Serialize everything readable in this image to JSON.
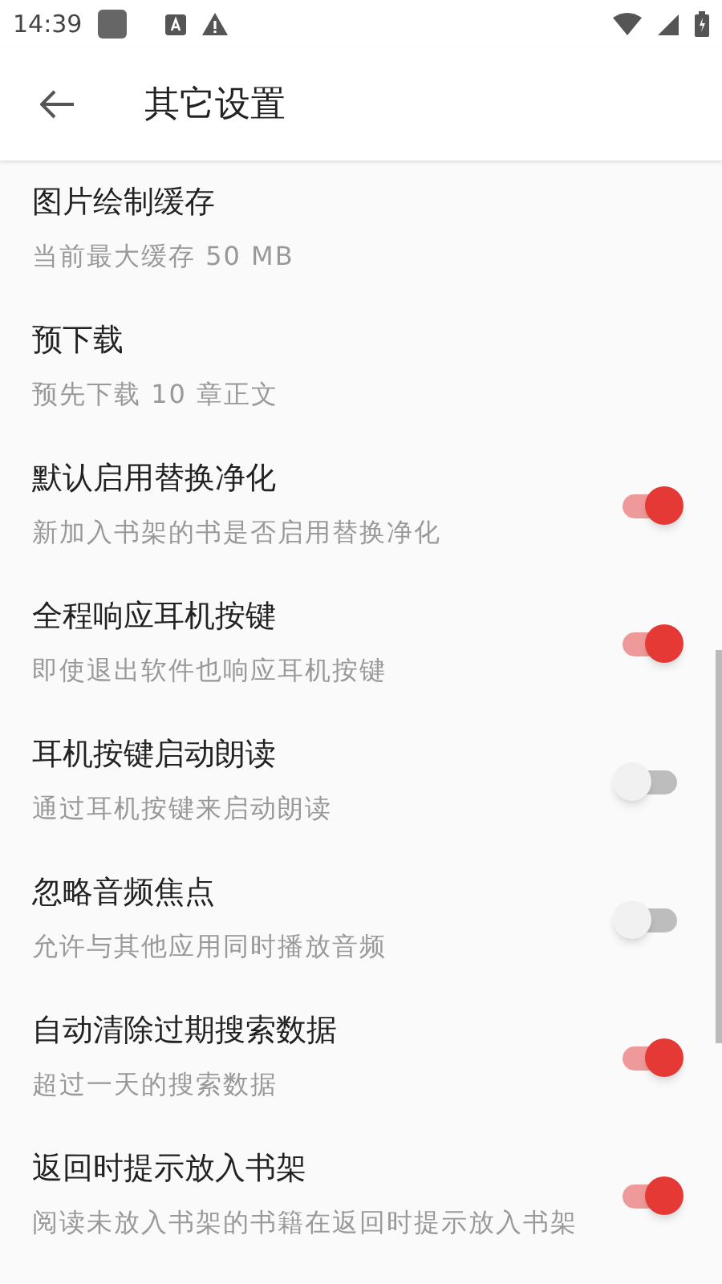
{
  "status_bar": {
    "time": "14:39"
  },
  "app_bar": {
    "title": "其它设置"
  },
  "settings": [
    {
      "kind": "text",
      "title": "图片绘制缓存",
      "summary": "当前最大缓存 50 MB"
    },
    {
      "kind": "text",
      "title": "预下载",
      "summary": "预先下载 10 章正文"
    },
    {
      "kind": "switch",
      "title": "默认启用替换净化",
      "summary": "新加入书架的书是否启用替换净化",
      "on": true
    },
    {
      "kind": "switch",
      "title": "全程响应耳机按键",
      "summary": "即使退出软件也响应耳机按键",
      "on": true
    },
    {
      "kind": "switch",
      "title": "耳机按键启动朗读",
      "summary": "通过耳机按键来启动朗读",
      "on": false
    },
    {
      "kind": "switch",
      "title": "忽略音频焦点",
      "summary": "允许与其他应用同时播放音频",
      "on": false
    },
    {
      "kind": "switch",
      "title": "自动清除过期搜索数据",
      "summary": "超过一天的搜索数据",
      "on": true
    },
    {
      "kind": "switch",
      "title": "返回时提示放入书架",
      "summary": "阅读未放入书架的书籍在返回时提示放入书架",
      "on": true
    }
  ]
}
